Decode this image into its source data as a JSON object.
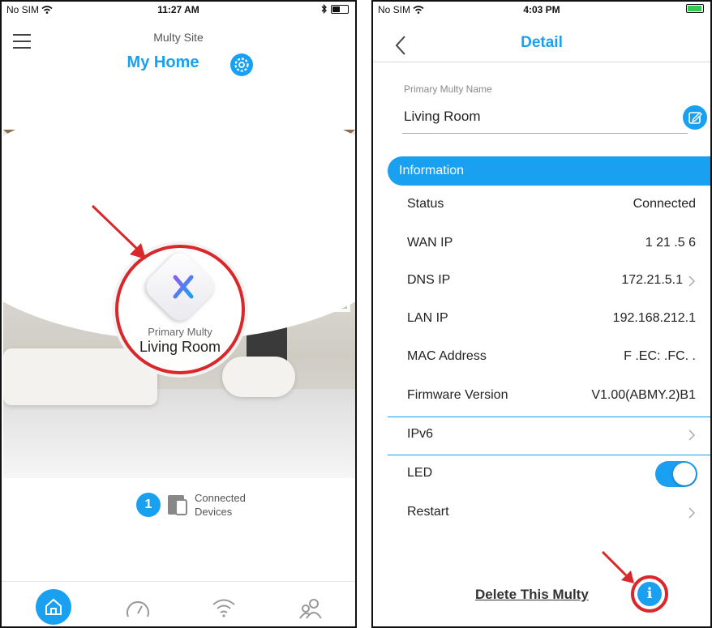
{
  "left_screen": {
    "status": {
      "carrier": "No SIM",
      "time": "11:27 AM"
    },
    "site_label": "Multy Site",
    "site_name": "My Home",
    "device": {
      "caption": "Primary Multy",
      "name": "Living Room"
    },
    "connected": {
      "count": "1",
      "label_line1": "Connected",
      "label_line2": "Devices"
    },
    "tabs": [
      "home-icon",
      "speedometer-icon",
      "wifi-icon",
      "users-icon"
    ],
    "colors": {
      "accent": "#19a0f0",
      "highlight": "#d8282b"
    }
  },
  "right_screen": {
    "status": {
      "carrier": "No SIM",
      "time": "4:03 PM"
    },
    "title": "Detail",
    "name_label": "Primary Multy Name",
    "name_value": "Living Room",
    "section_title": "Information",
    "info_rows": [
      {
        "label": "Status",
        "value": "Connected"
      },
      {
        "label": "WAN IP",
        "value": "1  21 .5   6"
      },
      {
        "label": "DNS IP",
        "value": "172.21.5.1"
      },
      {
        "label": "LAN IP",
        "value": "192.168.212.1"
      },
      {
        "label": "MAC Address",
        "value": "F  .EC:  .FC.  ."
      },
      {
        "label": "Firmware Version",
        "value": "V1.00(ABMY.2)B1"
      }
    ],
    "ipv6_label": "IPv6",
    "led_label": "LED",
    "led_on": true,
    "restart_label": "Restart",
    "delete_label": "Delete This Multy",
    "info_icon_glyph": "i"
  }
}
